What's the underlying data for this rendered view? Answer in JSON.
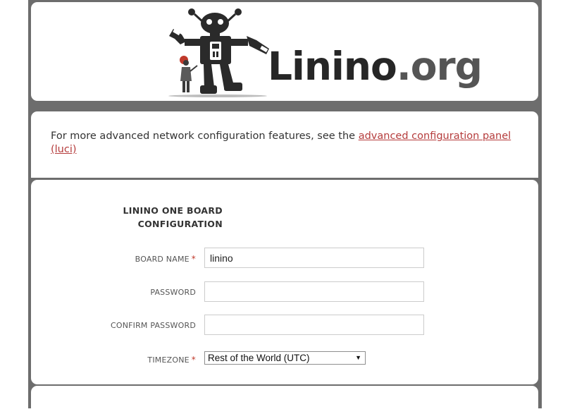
{
  "logo": {
    "brand_main": "Linino",
    "brand_suffix": ".org"
  },
  "info": {
    "text_prefix": "For more advanced network configuration features, see the ",
    "link_text": "advanced configuration panel (luci)"
  },
  "form": {
    "title_line1": "LININO ONE BOARD",
    "title_line2": "CONFIGURATION",
    "board_name": {
      "label": "BOARD NAME",
      "required": "*",
      "value": "linino"
    },
    "password": {
      "label": "PASSWORD",
      "value": ""
    },
    "confirm_password": {
      "label": "CONFIRM PASSWORD",
      "value": ""
    },
    "timezone": {
      "label": "TIMEZONE",
      "required": "*",
      "selected": "Rest of the World (UTC)",
      "arrow": "▼"
    }
  },
  "colors": {
    "frame": "#6d6d6d",
    "link": "#b53c3c",
    "required": "#c0392b"
  }
}
